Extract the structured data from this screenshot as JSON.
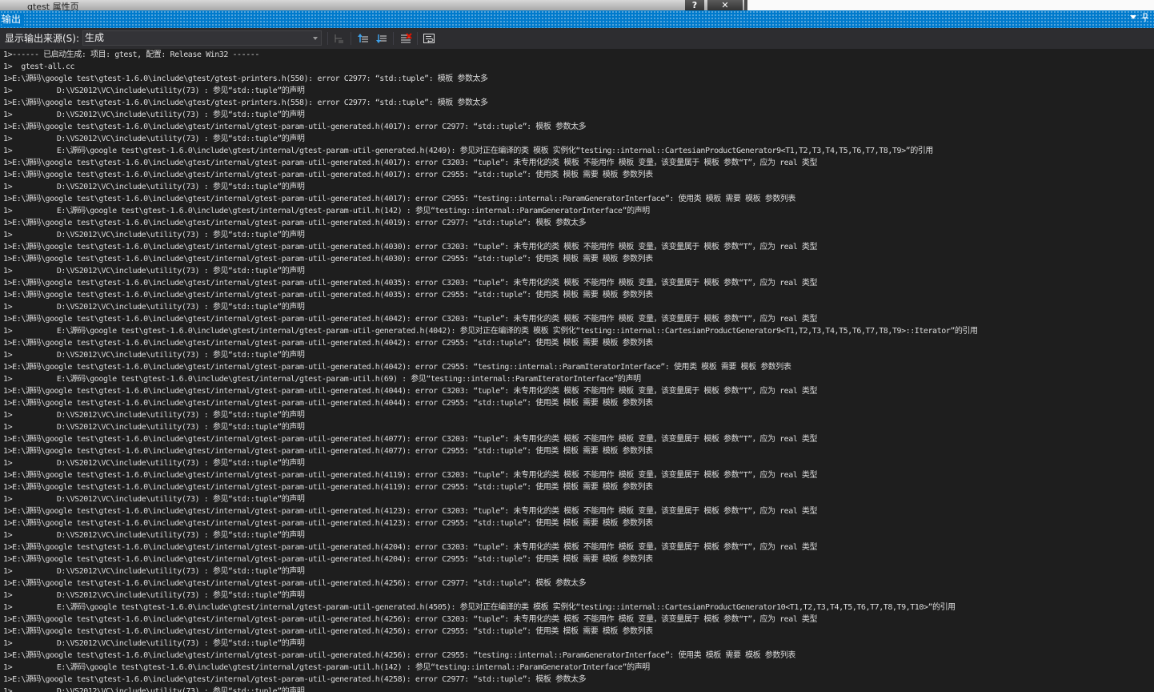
{
  "background_window": {
    "title": "gtest 属性页",
    "help_label": "?",
    "close_label": "✕"
  },
  "panel": {
    "title": "输出",
    "dropdown_icon": "chevron-down-icon",
    "pin_icon": "pin-icon"
  },
  "toolbar": {
    "source_label": "显示输出来源(S):",
    "source_value": "生成",
    "buttons": [
      "find-message-in-code-icon",
      "go-to-previous-message-icon",
      "go-to-next-message-icon",
      "clear-all-icon",
      "toggle-word-wrap-icon"
    ]
  },
  "colors": {
    "accent": "#007acc",
    "panel_bg": "#1e1e1e",
    "toolbar_bg": "#2d2d30",
    "text": "#dcdcdc"
  },
  "output_lines": [
    "1>------ 已启动生成: 项目: gtest, 配置: Release Win32 ------",
    "1>  gtest-all.cc",
    "1>E:\\源码\\google test\\gtest-1.6.0\\include\\gtest/gtest-printers.h(550): error C2977: “std::tuple”: 模板 参数太多",
    "1>          D:\\VS2012\\VC\\include\\utility(73) : 参见“std::tuple”的声明",
    "1>E:\\源码\\google test\\gtest-1.6.0\\include\\gtest/gtest-printers.h(558): error C2977: “std::tuple”: 模板 参数太多",
    "1>          D:\\VS2012\\VC\\include\\utility(73) : 参见“std::tuple”的声明",
    "1>E:\\源码\\google test\\gtest-1.6.0\\include\\gtest/internal/gtest-param-util-generated.h(4017): error C2977: “std::tuple”: 模板 参数太多",
    "1>          D:\\VS2012\\VC\\include\\utility(73) : 参见“std::tuple”的声明",
    "1>          E:\\源码\\google test\\gtest-1.6.0\\include\\gtest/internal/gtest-param-util-generated.h(4249): 参见对正在编译的类 模板 实例化“testing::internal::CartesianProductGenerator9<T1,T2,T3,T4,T5,T6,T7,T8,T9>”的引用",
    "1>E:\\源码\\google test\\gtest-1.6.0\\include\\gtest/internal/gtest-param-util-generated.h(4017): error C3203: “tuple”: 未专用化的类 模板 不能用作 模板 变量，该变量属于 模板 参数“T”，应为 real 类型",
    "1>E:\\源码\\google test\\gtest-1.6.0\\include\\gtest/internal/gtest-param-util-generated.h(4017): error C2955: “std::tuple”: 使用类 模板 需要 模板 参数列表",
    "1>          D:\\VS2012\\VC\\include\\utility(73) : 参见“std::tuple”的声明",
    "1>E:\\源码\\google test\\gtest-1.6.0\\include\\gtest/internal/gtest-param-util-generated.h(4017): error C2955: “testing::internal::ParamGeneratorInterface”: 使用类 模板 需要 模板 参数列表",
    "1>          E:\\源码\\google test\\gtest-1.6.0\\include\\gtest/internal/gtest-param-util.h(142) : 参见“testing::internal::ParamGeneratorInterface”的声明",
    "1>E:\\源码\\google test\\gtest-1.6.0\\include\\gtest/internal/gtest-param-util-generated.h(4019): error C2977: “std::tuple”: 模板 参数太多",
    "1>          D:\\VS2012\\VC\\include\\utility(73) : 参见“std::tuple”的声明",
    "1>E:\\源码\\google test\\gtest-1.6.0\\include\\gtest/internal/gtest-param-util-generated.h(4030): error C3203: “tuple”: 未专用化的类 模板 不能用作 模板 变量，该变量属于 模板 参数“T”，应为 real 类型",
    "1>E:\\源码\\google test\\gtest-1.6.0\\include\\gtest/internal/gtest-param-util-generated.h(4030): error C2955: “std::tuple”: 使用类 模板 需要 模板 参数列表",
    "1>          D:\\VS2012\\VC\\include\\utility(73) : 参见“std::tuple”的声明",
    "1>E:\\源码\\google test\\gtest-1.6.0\\include\\gtest/internal/gtest-param-util-generated.h(4035): error C3203: “tuple”: 未专用化的类 模板 不能用作 模板 变量，该变量属于 模板 参数“T”，应为 real 类型",
    "1>E:\\源码\\google test\\gtest-1.6.0\\include\\gtest/internal/gtest-param-util-generated.h(4035): error C2955: “std::tuple”: 使用类 模板 需要 模板 参数列表",
    "1>          D:\\VS2012\\VC\\include\\utility(73) : 参见“std::tuple”的声明",
    "1>E:\\源码\\google test\\gtest-1.6.0\\include\\gtest/internal/gtest-param-util-generated.h(4042): error C3203: “tuple”: 未专用化的类 模板 不能用作 模板 变量，该变量属于 模板 参数“T”，应为 real 类型",
    "1>          E:\\源码\\google test\\gtest-1.6.0\\include\\gtest/internal/gtest-param-util-generated.h(4042): 参见对正在编译的类 模板 实例化“testing::internal::CartesianProductGenerator9<T1,T2,T3,T4,T5,T6,T7,T8,T9>::Iterator”的引用",
    "1>E:\\源码\\google test\\gtest-1.6.0\\include\\gtest/internal/gtest-param-util-generated.h(4042): error C2955: “std::tuple”: 使用类 模板 需要 模板 参数列表",
    "1>          D:\\VS2012\\VC\\include\\utility(73) : 参见“std::tuple”的声明",
    "1>E:\\源码\\google test\\gtest-1.6.0\\include\\gtest/internal/gtest-param-util-generated.h(4042): error C2955: “testing::internal::ParamIteratorInterface”: 使用类 模板 需要 模板 参数列表",
    "1>          E:\\源码\\google test\\gtest-1.6.0\\include\\gtest/internal/gtest-param-util.h(69) : 参见“testing::internal::ParamIteratorInterface”的声明",
    "1>E:\\源码\\google test\\gtest-1.6.0\\include\\gtest/internal/gtest-param-util-generated.h(4044): error C3203: “tuple”: 未专用化的类 模板 不能用作 模板 变量，该变量属于 模板 参数“T”，应为 real 类型",
    "1>E:\\源码\\google test\\gtest-1.6.0\\include\\gtest/internal/gtest-param-util-generated.h(4044): error C2955: “std::tuple”: 使用类 模板 需要 模板 参数列表",
    "1>          D:\\VS2012\\VC\\include\\utility(73) : 参见“std::tuple”的声明",
    "1>          D:\\VS2012\\VC\\include\\utility(73) : 参见“std::tuple”的声明",
    "1>E:\\源码\\google test\\gtest-1.6.0\\include\\gtest/internal/gtest-param-util-generated.h(4077): error C3203: “tuple”: 未专用化的类 模板 不能用作 模板 变量，该变量属于 模板 参数“T”，应为 real 类型",
    "1>E:\\源码\\google test\\gtest-1.6.0\\include\\gtest/internal/gtest-param-util-generated.h(4077): error C2955: “std::tuple”: 使用类 模板 需要 模板 参数列表",
    "1>          D:\\VS2012\\VC\\include\\utility(73) : 参见“std::tuple”的声明",
    "1>E:\\源码\\google test\\gtest-1.6.0\\include\\gtest/internal/gtest-param-util-generated.h(4119): error C3203: “tuple”: 未专用化的类 模板 不能用作 模板 变量，该变量属于 模板 参数“T”，应为 real 类型",
    "1>E:\\源码\\google test\\gtest-1.6.0\\include\\gtest/internal/gtest-param-util-generated.h(4119): error C2955: “std::tuple”: 使用类 模板 需要 模板 参数列表",
    "1>          D:\\VS2012\\VC\\include\\utility(73) : 参见“std::tuple”的声明",
    "1>E:\\源码\\google test\\gtest-1.6.0\\include\\gtest/internal/gtest-param-util-generated.h(4123): error C3203: “tuple”: 未专用化的类 模板 不能用作 模板 变量，该变量属于 模板 参数“T”，应为 real 类型",
    "1>E:\\源码\\google test\\gtest-1.6.0\\include\\gtest/internal/gtest-param-util-generated.h(4123): error C2955: “std::tuple”: 使用类 模板 需要 模板 参数列表",
    "1>          D:\\VS2012\\VC\\include\\utility(73) : 参见“std::tuple”的声明",
    "1>E:\\源码\\google test\\gtest-1.6.0\\include\\gtest/internal/gtest-param-util-generated.h(4204): error C3203: “tuple”: 未专用化的类 模板 不能用作 模板 变量，该变量属于 模板 参数“T”，应为 real 类型",
    "1>E:\\源码\\google test\\gtest-1.6.0\\include\\gtest/internal/gtest-param-util-generated.h(4204): error C2955: “std::tuple”: 使用类 模板 需要 模板 参数列表",
    "1>          D:\\VS2012\\VC\\include\\utility(73) : 参见“std::tuple”的声明",
    "1>E:\\源码\\google test\\gtest-1.6.0\\include\\gtest/internal/gtest-param-util-generated.h(4256): error C2977: “std::tuple”: 模板 参数太多",
    "1>          D:\\VS2012\\VC\\include\\utility(73) : 参见“std::tuple”的声明",
    "1>          E:\\源码\\google test\\gtest-1.6.0\\include\\gtest/internal/gtest-param-util-generated.h(4505): 参见对正在编译的类 模板 实例化“testing::internal::CartesianProductGenerator10<T1,T2,T3,T4,T5,T6,T7,T8,T9,T10>”的引用",
    "1>E:\\源码\\google test\\gtest-1.6.0\\include\\gtest/internal/gtest-param-util-generated.h(4256): error C3203: “tuple”: 未专用化的类 模板 不能用作 模板 变量，该变量属于 模板 参数“T”，应为 real 类型",
    "1>E:\\源码\\google test\\gtest-1.6.0\\include\\gtest/internal/gtest-param-util-generated.h(4256): error C2955: “std::tuple”: 使用类 模板 需要 模板 参数列表",
    "1>          D:\\VS2012\\VC\\include\\utility(73) : 参见“std::tuple”的声明",
    "1>E:\\源码\\google test\\gtest-1.6.0\\include\\gtest/internal/gtest-param-util-generated.h(4256): error C2955: “testing::internal::ParamGeneratorInterface”: 使用类 模板 需要 模板 参数列表",
    "1>          E:\\源码\\google test\\gtest-1.6.0\\include\\gtest/internal/gtest-param-util.h(142) : 参见“testing::internal::ParamGeneratorInterface”的声明",
    "1>E:\\源码\\google test\\gtest-1.6.0\\include\\gtest/internal/gtest-param-util-generated.h(4258): error C2977: “std::tuple”: 模板 参数太多",
    "1>          D:\\VS2012\\VC\\include\\utility(73) : 参见“std::tuple”的声明"
  ]
}
